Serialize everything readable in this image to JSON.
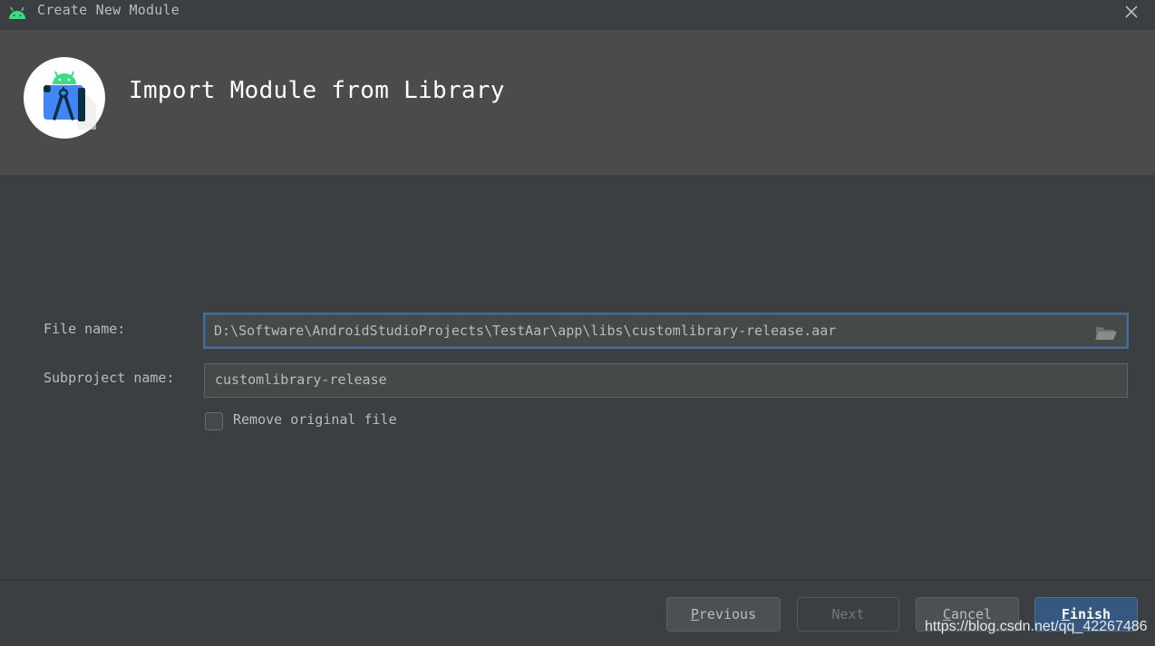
{
  "window": {
    "title": "Create New Module",
    "app_icon": "android-icon",
    "close_icon": "close-icon"
  },
  "header": {
    "logo_icon": "android-studio-logo-icon",
    "heading": "Import Module from Library"
  },
  "form": {
    "file_name": {
      "label": "File name:",
      "value": "D:\\Software\\AndroidStudioProjects\\TestAar\\app\\libs\\customlibrary-release.aar",
      "browse_icon": "folder-open-icon"
    },
    "subproject_name": {
      "label": "Subproject name:",
      "value": "customlibrary-release"
    },
    "remove_original": {
      "label": "Remove original file",
      "checked": false
    }
  },
  "footer": {
    "previous": {
      "mnemonic": "P",
      "rest": "revious"
    },
    "next": {
      "label": "Next",
      "enabled": false
    },
    "cancel": {
      "mnemonic": "C",
      "rest": "ancel"
    },
    "finish": {
      "mnemonic": "F",
      "rest": "inish"
    }
  },
  "watermark": "https://blog.csdn.net/qq_42267486",
  "colors": {
    "background": "#3c3f41",
    "header_bg": "#4b4b4b",
    "focus_border": "#466d94",
    "primary_button": "#365880",
    "android_green": "#3ddc84"
  }
}
